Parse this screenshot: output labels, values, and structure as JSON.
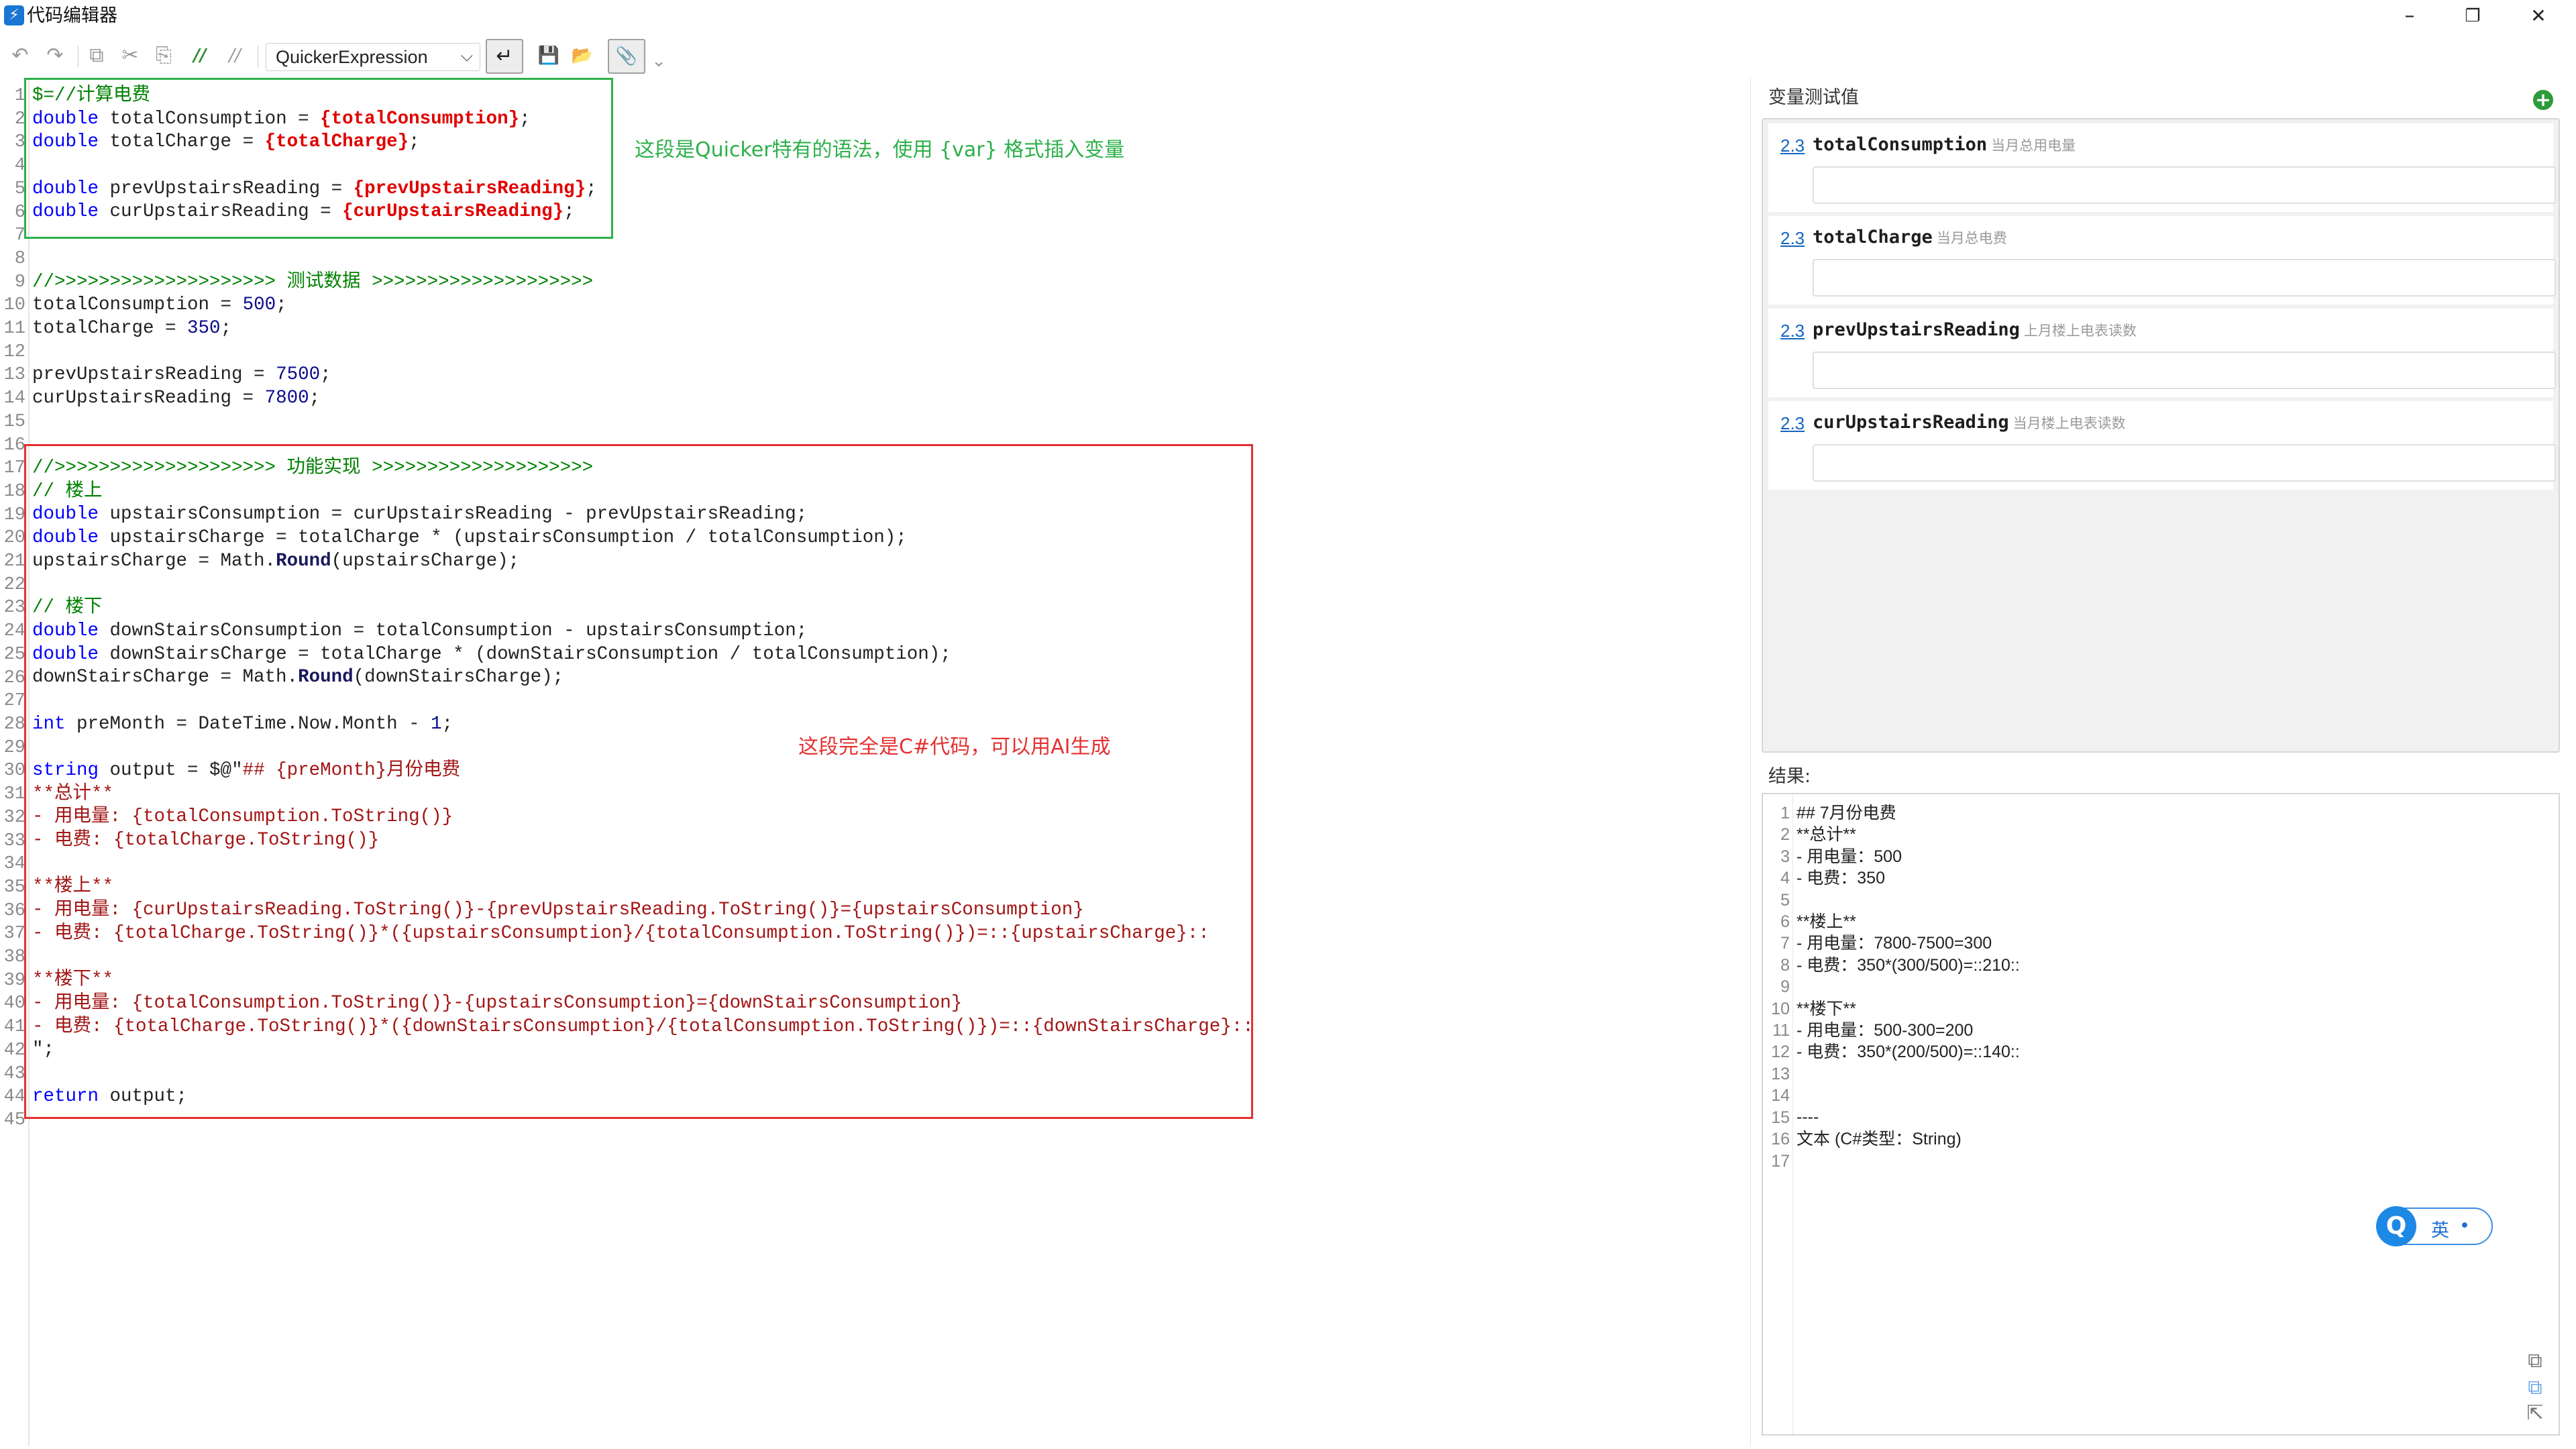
{
  "window": {
    "title": "代码编辑器",
    "app_icon_glyph": "⚡",
    "minimize_glyph": "–",
    "maximize_glyph": "❐",
    "close_glyph": "✕"
  },
  "toolbar": {
    "undo_glyph": "↶",
    "redo_glyph": "↷",
    "copy_glyph": "⧉",
    "cut_glyph": "✂",
    "paste_glyph": "⎘",
    "comment_glyph": "//",
    "uncomment_glyph": "//",
    "language": "QuickerExpression",
    "wrap_glyph": "↵",
    "save_glyph": "💾",
    "open_glyph": "📂",
    "pin_glyph": "📎",
    "more_glyph": "⌄"
  },
  "annotations": {
    "green": "这段是Quicker特有的语法，使用 {var} 格式插入变量",
    "red": "这段完全是C#代码，可以用AI生成"
  },
  "editor": {
    "line_numbers": "1\n2\n3\n4\n5\n6\n7\n8\n9\n10\n11\n12\n13\n14\n15\n16\n17\n18\n19\n20\n21\n22\n23\n24\n25\n26\n27\n28\n29\n30\n31\n32\n33\n34\n35\n36\n37\n38\n39\n40\n41\n42\n43\n44\n45",
    "lines": [
      [
        {
          "t": "$=//计算电费",
          "c": "cm"
        }
      ],
      [
        {
          "t": "double",
          "c": "kw"
        },
        {
          "t": " totalConsumption = "
        },
        {
          "t": "{totalConsumption}",
          "c": "var"
        },
        {
          "t": ";"
        }
      ],
      [
        {
          "t": "double",
          "c": "kw"
        },
        {
          "t": " totalCharge = "
        },
        {
          "t": "{totalCharge}",
          "c": "var"
        },
        {
          "t": ";"
        }
      ],
      [],
      [
        {
          "t": "double",
          "c": "kw"
        },
        {
          "t": " prevUpstairsReading = "
        },
        {
          "t": "{prevUpstairsReading}",
          "c": "var"
        },
        {
          "t": ";"
        }
      ],
      [
        {
          "t": "double",
          "c": "kw"
        },
        {
          "t": " curUpstairsReading = "
        },
        {
          "t": "{curUpstairsReading}",
          "c": "var"
        },
        {
          "t": ";"
        }
      ],
      [],
      [],
      [
        {
          "t": "//>>>>>>>>>>>>>>>>>>>> 测试数据 >>>>>>>>>>>>>>>>>>>>",
          "c": "cm"
        }
      ],
      [
        {
          "t": "totalConsumption = "
        },
        {
          "t": "500",
          "c": "num"
        },
        {
          "t": ";"
        }
      ],
      [
        {
          "t": "totalCharge = "
        },
        {
          "t": "350",
          "c": "num"
        },
        {
          "t": ";"
        }
      ],
      [],
      [
        {
          "t": "prevUpstairsReading = "
        },
        {
          "t": "7500",
          "c": "num"
        },
        {
          "t": ";"
        }
      ],
      [
        {
          "t": "curUpstairsReading = "
        },
        {
          "t": "7800",
          "c": "num"
        },
        {
          "t": ";"
        }
      ],
      [],
      [],
      [
        {
          "t": "//>>>>>>>>>>>>>>>>>>>> 功能实现 >>>>>>>>>>>>>>>>>>>>",
          "c": "cm"
        }
      ],
      [
        {
          "t": "// 楼上",
          "c": "cm"
        }
      ],
      [
        {
          "t": "double",
          "c": "kw"
        },
        {
          "t": " upstairsConsumption = curUpstairsReading - prevUpstairsReading;"
        }
      ],
      [
        {
          "t": "double",
          "c": "kw"
        },
        {
          "t": " upstairsCharge = totalCharge * (upstairsConsumption / totalConsumption);"
        }
      ],
      [
        {
          "t": "upstairsCharge = Math."
        },
        {
          "t": "Round",
          "c": "fn"
        },
        {
          "t": "(upstairsCharge);"
        }
      ],
      [],
      [
        {
          "t": "// 楼下",
          "c": "cm"
        }
      ],
      [
        {
          "t": "double",
          "c": "kw"
        },
        {
          "t": " downStairsConsumption = totalConsumption - upstairsConsumption;"
        }
      ],
      [
        {
          "t": "double",
          "c": "kw"
        },
        {
          "t": " downStairsCharge = totalCharge * (downStairsConsumption / totalConsumption);"
        }
      ],
      [
        {
          "t": "downStairsCharge = Math."
        },
        {
          "t": "Round",
          "c": "fn"
        },
        {
          "t": "(downStairsCharge);"
        }
      ],
      [],
      [
        {
          "t": "int",
          "c": "kw"
        },
        {
          "t": " preMonth = DateTime.Now.Month - "
        },
        {
          "t": "1",
          "c": "num"
        },
        {
          "t": ";"
        }
      ],
      [],
      [
        {
          "t": "string",
          "c": "kw"
        },
        {
          "t": " output = $@\""
        },
        {
          "t": "## {preMonth}月份电费",
          "c": "str"
        }
      ],
      [
        {
          "t": "**总计**",
          "c": "str"
        }
      ],
      [
        {
          "t": "- 用电量: {totalConsumption.ToString()}",
          "c": "str"
        }
      ],
      [
        {
          "t": "- 电费: {totalCharge.ToString()}",
          "c": "str"
        }
      ],
      [],
      [
        {
          "t": "**楼上**",
          "c": "str"
        }
      ],
      [
        {
          "t": "- 用电量: {curUpstairsReading.ToString()}-{prevUpstairsReading.ToString()}={upstairsConsumption}",
          "c": "str"
        }
      ],
      [
        {
          "t": "- 电费: {totalCharge.ToString()}*({upstairsConsumption}/{totalConsumption.ToString()})=::{upstairsCharge}::",
          "c": "str"
        }
      ],
      [],
      [
        {
          "t": "**楼下**",
          "c": "str"
        }
      ],
      [
        {
          "t": "- 用电量: {totalConsumption.ToString()}-{upstairsConsumption}={downStairsConsumption}",
          "c": "str"
        }
      ],
      [
        {
          "t": "- 电费: {totalCharge.ToString()}*({downStairsConsumption}/{totalConsumption.ToString()})=::{downStairsCharge}::",
          "c": "str"
        }
      ],
      [
        {
          "t": "\";"
        }
      ],
      [],
      [
        {
          "t": "return",
          "c": "kw"
        },
        {
          "t": " output;"
        }
      ],
      []
    ]
  },
  "variables_panel": {
    "header": "变量测试值",
    "add_glyph": "+",
    "items": [
      {
        "type_icon": "2.3",
        "name": "totalConsumption",
        "desc": "当月总用电量",
        "value": ""
      },
      {
        "type_icon": "2.3",
        "name": "totalCharge",
        "desc": "当月总电费",
        "value": ""
      },
      {
        "type_icon": "2.3",
        "name": "prevUpstairsReading",
        "desc": "上月楼上电表读数",
        "value": ""
      },
      {
        "type_icon": "2.3",
        "name": "curUpstairsReading",
        "desc": "当月楼上电表读数",
        "value": ""
      }
    ]
  },
  "result_panel": {
    "label": "结果:",
    "line_numbers": "1\n2\n3\n4\n5\n6\n7\n8\n9\n10\n11\n12\n13\n14\n15\n16\n17",
    "lines": [
      "## 7月份电费",
      "**总计**",
      "- 用电量：500",
      "- 电费：350",
      "",
      "**楼上**",
      "- 用电量：7800-7500=300",
      "- 电费：350*(300/500)=::210::",
      "",
      "**楼下**",
      "- 用电量：500-300=200",
      "- 电费：350*(200/500)=::140::",
      "",
      "",
      "----",
      "文本 (C#类型：String)",
      ""
    ],
    "copy_glyph": "⧉",
    "copy2_glyph": "⧉",
    "expand_glyph": "⇱"
  },
  "ime": {
    "logo": "Q",
    "lang": "英",
    "punct": "•"
  }
}
